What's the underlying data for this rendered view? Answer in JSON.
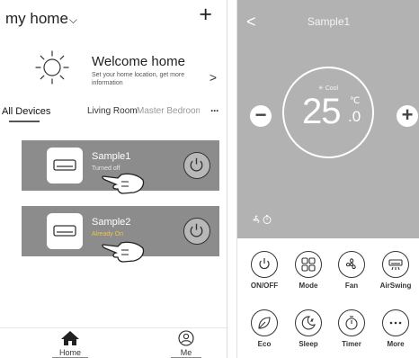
{
  "left": {
    "title": "my home",
    "chevron": "⌵",
    "add_glyph": "+",
    "welcome": {
      "title": "Welcome home",
      "subtitle": "Set your home location, get more information",
      "arrow": ">"
    },
    "tabs": [
      {
        "label": "All Devices"
      },
      {
        "label": "Living Room"
      },
      {
        "label": "Master Bedroom"
      }
    ],
    "more_glyph": "···",
    "devices": [
      {
        "name": "Sample1",
        "status": "Turned off"
      },
      {
        "name": "Sample2",
        "status": "Already On"
      }
    ],
    "nav": {
      "home": "Home",
      "me": "Me"
    }
  },
  "right": {
    "back_glyph": "<",
    "device_title": "Sample1",
    "mode": "✳ Cool",
    "temperature": "25",
    "temperature_decimal": ".0",
    "unit": "℃",
    "minus_glyph": "−",
    "plus_glyph": "+",
    "controls": [
      {
        "label": "ON/OFF",
        "icon": "power-icon"
      },
      {
        "label": "Mode",
        "icon": "mode-grid-icon"
      },
      {
        "label": "Fan",
        "icon": "fan-icon"
      },
      {
        "label": "AirSwing",
        "icon": "airswing-icon"
      },
      {
        "label": "Eco",
        "icon": "leaf-icon"
      },
      {
        "label": "Sleep",
        "icon": "sleep-icon"
      },
      {
        "label": "Timer",
        "icon": "timer-icon"
      },
      {
        "label": "More",
        "icon": "more-icon"
      }
    ],
    "colors": {
      "panel": "#b2b2b2",
      "device_card": "#8c8c8c",
      "status_on": "#e9c64a"
    }
  }
}
